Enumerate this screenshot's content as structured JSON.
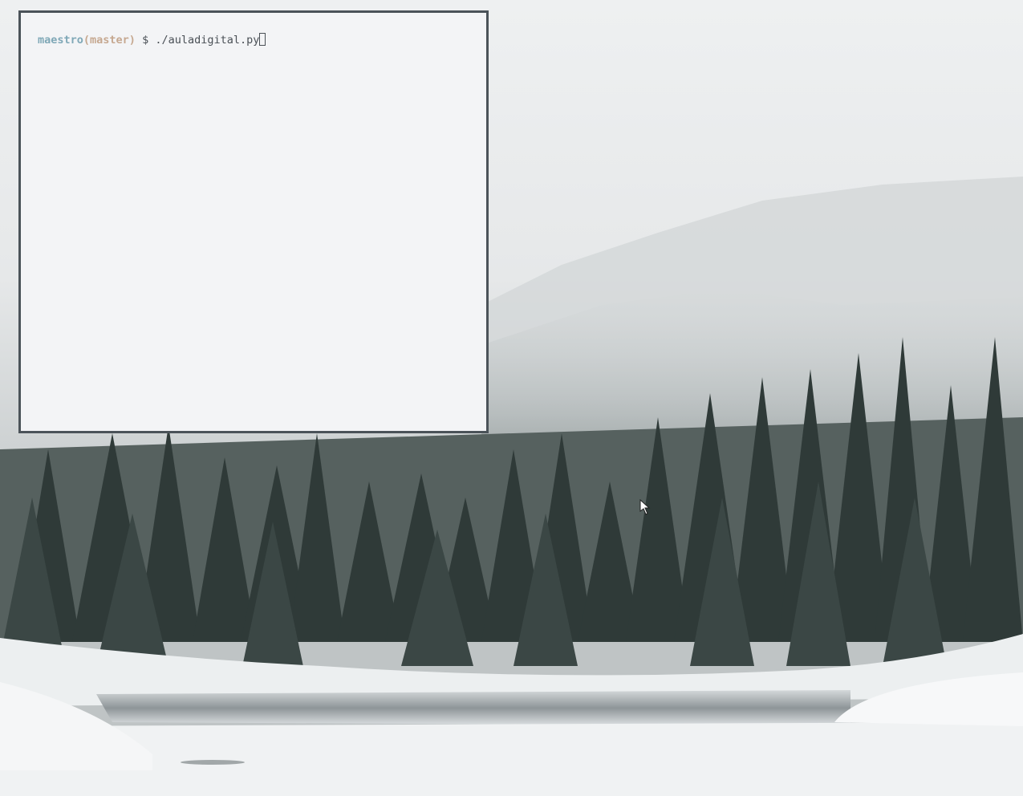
{
  "desktop": {
    "wallpaper": "snowy-forest-lake",
    "colors": {
      "fog": "#e9ebec",
      "trees": "#3d4846",
      "snow": "#f1f2f3",
      "water": "#9ea3a5"
    }
  },
  "terminal": {
    "prompt_user": "maestro",
    "prompt_branch": "(master)",
    "prompt_symbol": " $ ",
    "command": "./auladigital.py",
    "colors": {
      "background": "#f3f4f6",
      "border": "#4b5359",
      "user": "#7fa8b7",
      "branch": "#c6a890",
      "text": "#4a5056"
    }
  },
  "pointer": {
    "icon": "mouse-pointer-icon"
  }
}
